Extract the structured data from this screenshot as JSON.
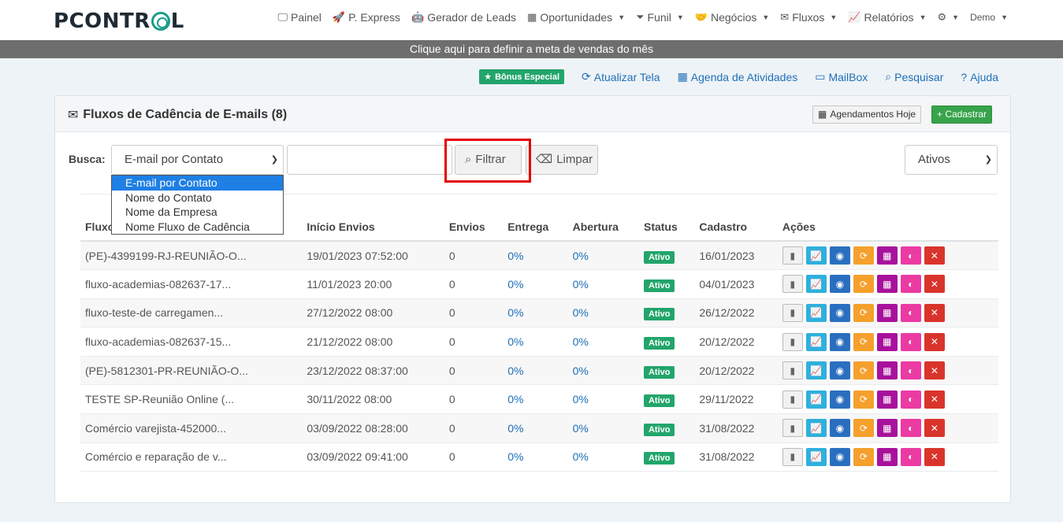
{
  "nav": {
    "brand": "PCONTROL",
    "items": [
      {
        "label": "Painel",
        "icon": "monitor-icon",
        "glyph": "🖵"
      },
      {
        "label": "P. Express",
        "icon": "rocket-icon",
        "glyph": "🚀"
      },
      {
        "label": "Gerador de Leads",
        "icon": "robot-icon",
        "glyph": "🤖"
      },
      {
        "label": "Oportunidades",
        "icon": "board-icon",
        "glyph": "▦"
      },
      {
        "label": "Funil",
        "icon": "funnel-icon",
        "glyph": "⏷"
      },
      {
        "label": "Negócios",
        "icon": "handshake-icon",
        "glyph": "🤝"
      },
      {
        "label": "Fluxos",
        "icon": "envelope-icon",
        "glyph": "✉"
      },
      {
        "label": "Relatórios",
        "icon": "chart-line-icon",
        "glyph": "📈"
      }
    ],
    "user": "Demo"
  },
  "banner": "Clique aqui para definir a meta de vendas do mês",
  "quick": {
    "bonus": "Bônus Especial",
    "links": [
      {
        "label": "Atualizar Tela",
        "icon": "refresh-icon",
        "glyph": "⟳"
      },
      {
        "label": "Agenda de Atividades",
        "icon": "calendar-icon",
        "glyph": "▦"
      },
      {
        "label": "MailBox",
        "icon": "mailbox-icon",
        "glyph": "▭"
      },
      {
        "label": "Pesquisar",
        "icon": "search-icon",
        "glyph": "⌕"
      },
      {
        "label": "Ajuda",
        "icon": "help-icon",
        "glyph": "?"
      }
    ]
  },
  "panel": {
    "title": "Fluxos de Cadência de E-mails (8)",
    "btn_agenda": "Agendamentos Hoje",
    "btn_cadastrar": "+ Cadastrar"
  },
  "filter": {
    "label": "Busca:",
    "selected": "E-mail por Contato",
    "options": [
      "E-mail por Contato",
      "Nome do Contato",
      "Nome da Empresa",
      "Nome Fluxo de Cadência"
    ],
    "filtrar": "Filtrar",
    "limpar": "Limpar",
    "status": "Ativos"
  },
  "table": {
    "headers": [
      "Fluxo",
      "Início Envios",
      "Envios",
      "Entrega",
      "Abertura",
      "Status",
      "Cadastro",
      "Ações"
    ],
    "rows": [
      {
        "fluxo": "(PE)-4399199-RJ-REUNIÃO-O...",
        "inicio": "19/01/2023 07:52:00",
        "envios": "0",
        "entrega": "0%",
        "abertura": "0%",
        "status": "Ativo",
        "cadastro": "16/01/2023"
      },
      {
        "fluxo": "fluxo-academias-082637-17...",
        "inicio": "11/01/2023 20:00",
        "envios": "0",
        "entrega": "0%",
        "abertura": "0%",
        "status": "Ativo",
        "cadastro": "04/01/2023"
      },
      {
        "fluxo": "fluxo-teste-de carregamen...",
        "inicio": "27/12/2022 08:00",
        "envios": "0",
        "entrega": "0%",
        "abertura": "0%",
        "status": "Ativo",
        "cadastro": "26/12/2022"
      },
      {
        "fluxo": "fluxo-academias-082637-15...",
        "inicio": "21/12/2022 08:00",
        "envios": "0",
        "entrega": "0%",
        "abertura": "0%",
        "status": "Ativo",
        "cadastro": "20/12/2022"
      },
      {
        "fluxo": "(PE)-5812301-PR-REUNIÃO-O...",
        "inicio": "23/12/2022 08:37:00",
        "envios": "0",
        "entrega": "0%",
        "abertura": "0%",
        "status": "Ativo",
        "cadastro": "20/12/2022"
      },
      {
        "fluxo": "TESTE SP-Reunião Online (...",
        "inicio": "30/11/2022 08:00",
        "envios": "0",
        "entrega": "0%",
        "abertura": "0%",
        "status": "Ativo",
        "cadastro": "29/11/2022"
      },
      {
        "fluxo": "Comércio varejista-452000...",
        "inicio": "03/09/2022 08:28:00",
        "envios": "0",
        "entrega": "0%",
        "abertura": "0%",
        "status": "Ativo",
        "cadastro": "31/08/2022"
      },
      {
        "fluxo": "Comércio e reparação de v...",
        "inicio": "03/09/2022 09:41:00",
        "envios": "0",
        "entrega": "0%",
        "abertura": "0%",
        "status": "Ativo",
        "cadastro": "31/08/2022"
      }
    ],
    "actions": [
      {
        "name": "signal-icon",
        "cls": "a-gray",
        "glyph": "▮"
      },
      {
        "name": "line-chart-icon",
        "cls": "a-cyan",
        "glyph": "📈"
      },
      {
        "name": "eye-icon",
        "cls": "a-blue",
        "glyph": "◉"
      },
      {
        "name": "sync-icon",
        "cls": "a-orange",
        "glyph": "⟳"
      },
      {
        "name": "calendar-icon",
        "cls": "a-purple",
        "glyph": "▦"
      },
      {
        "name": "contrast-icon",
        "cls": "a-pink",
        "glyph": "◐"
      },
      {
        "name": "close-icon",
        "cls": "a-red",
        "glyph": "✕"
      }
    ]
  }
}
